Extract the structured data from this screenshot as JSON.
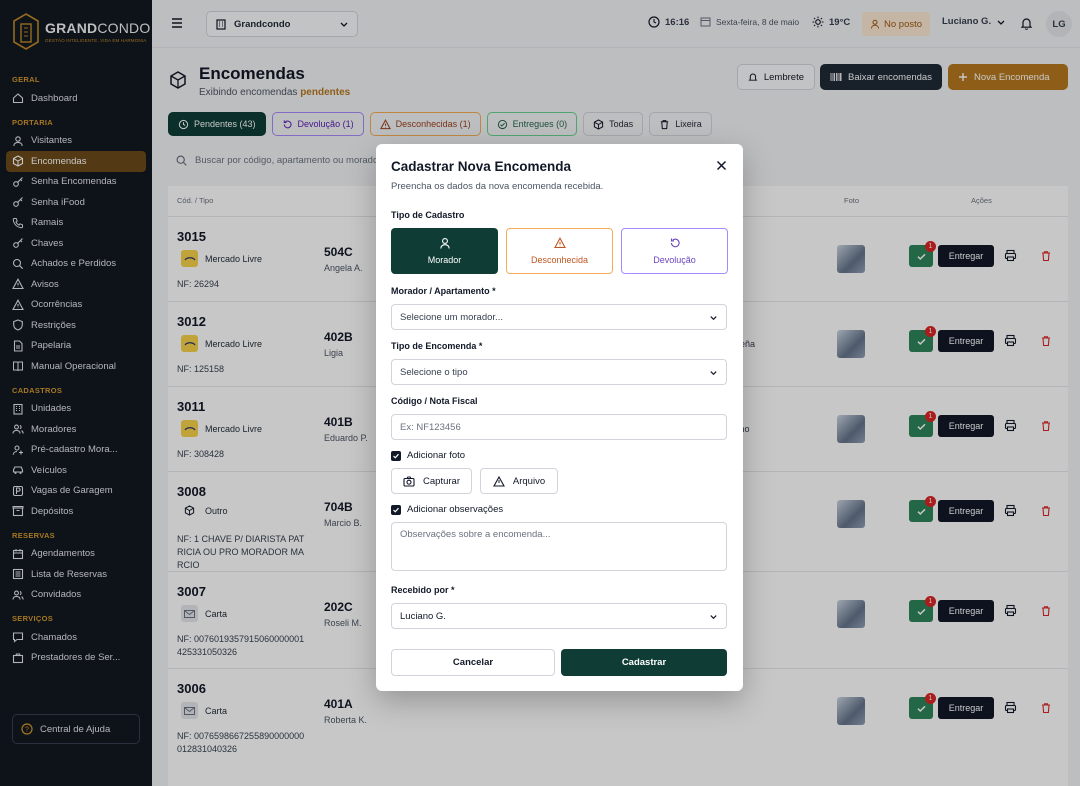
{
  "brand": {
    "name_bold": "GRAND",
    "name_rest": "CONDO",
    "tagline": "GESTÃO INTELIGENTE, VIDA EM HARMONIA"
  },
  "sidebar": {
    "sections": [
      {
        "title": "GERAL",
        "items": [
          {
            "label": "Dashboard",
            "icon": "home-icon"
          }
        ]
      },
      {
        "title": "PORTARIA",
        "items": [
          {
            "label": "Visitantes",
            "icon": "user-icon"
          },
          {
            "label": "Encomendas",
            "icon": "package-icon",
            "active": true
          },
          {
            "label": "Senha Encomendas",
            "icon": "key-icon"
          },
          {
            "label": "Senha iFood",
            "icon": "key-icon"
          },
          {
            "label": "Ramais",
            "icon": "phone-icon"
          },
          {
            "label": "Chaves",
            "icon": "key-icon"
          },
          {
            "label": "Achados e Perdidos",
            "icon": "search-icon"
          },
          {
            "label": "Avisos",
            "icon": "alert-icon"
          },
          {
            "label": "Ocorrências",
            "icon": "alert-icon"
          },
          {
            "label": "Restrições",
            "icon": "shield-icon"
          },
          {
            "label": "Papelaria",
            "icon": "file-icon"
          },
          {
            "label": "Manual Operacional",
            "icon": "book-icon"
          }
        ]
      },
      {
        "title": "CADASTROS",
        "items": [
          {
            "label": "Unidades",
            "icon": "building-icon"
          },
          {
            "label": "Moradores",
            "icon": "users-icon"
          },
          {
            "label": "Pré-cadastro Mora...",
            "icon": "user-plus-icon"
          },
          {
            "label": "Veículos",
            "icon": "car-icon"
          },
          {
            "label": "Vagas de Garagem",
            "icon": "parking-icon"
          },
          {
            "label": "Depósitos",
            "icon": "box-icon"
          }
        ]
      },
      {
        "title": "RESERVAS",
        "items": [
          {
            "label": "Agendamentos",
            "icon": "calendar-icon"
          },
          {
            "label": "Lista de Reservas",
            "icon": "list-icon"
          },
          {
            "label": "Convidados",
            "icon": "users-icon"
          }
        ]
      },
      {
        "title": "SERVIÇOS",
        "items": [
          {
            "label": "Chamados",
            "icon": "chat-icon"
          },
          {
            "label": "Prestadores de Ser...",
            "icon": "briefcase-icon"
          }
        ]
      }
    ],
    "help_label": "Central de Ajuda"
  },
  "topbar": {
    "condo": "Grandcondo",
    "time": "16:16",
    "date": "Sexta-feira, 8 de maio",
    "weather": "19°C",
    "status": "No posto",
    "user": "Luciano G.",
    "initials": "LG"
  },
  "page": {
    "title": "Encomendas",
    "subtitle_prefix": "Exibindo encomendas",
    "subtitle_highlight": "pendentes",
    "buttons": {
      "lembrete": "Lembrete",
      "baixar": "Baixar encomendas",
      "nova": "Nova Encomenda"
    },
    "tabs": [
      {
        "label": "Pendentes (43)",
        "kind": "active",
        "icon": "clock-icon"
      },
      {
        "label": "Devolução (1)",
        "kind": "dev",
        "icon": "undo-icon"
      },
      {
        "label": "Desconhecidas (1)",
        "kind": "desc",
        "icon": "alert-icon"
      },
      {
        "label": "Entregues (0)",
        "kind": "ent",
        "icon": "check-circle-icon"
      },
      {
        "label": "Todas",
        "kind": "",
        "icon": "package-icon"
      },
      {
        "label": "Lixeira",
        "kind": "",
        "icon": "trash-icon"
      }
    ],
    "search_placeholder": "Buscar por código, apartamento ou morador..."
  },
  "table": {
    "headers": {
      "code": "Cód. / Tipo",
      "photo": "Foto",
      "actions": "Ações"
    },
    "action_label": "Entregar",
    "badge": "1",
    "rows": [
      {
        "code": "3015",
        "carrier": "Mercado Livre",
        "carrier_kind": "ml",
        "nf": "NF: 26294",
        "apt": "504C",
        "resident": "Angela A."
      },
      {
        "code": "3012",
        "carrier": "Mercado Livre",
        "carrier_kind": "ml",
        "nf": "NF: 125158",
        "apt": "402B",
        "resident": "Ligia"
      },
      {
        "code": "3011",
        "carrier": "Mercado Livre",
        "carrier_kind": "ml",
        "nf": "NF: 308428",
        "apt": "401B",
        "resident": "Eduardo P."
      },
      {
        "code": "3008",
        "carrier": "Outro",
        "carrier_kind": "outro",
        "nf": "NF: 1 CHAVE P/ DIARISTA PATRICIA OU PRO MORADOR MARCIO",
        "apt": "704B",
        "resident": "Marcio B."
      },
      {
        "code": "3007",
        "carrier": "Carta",
        "carrier_kind": "carta",
        "nf": "NF: 0076019357915060000001425331050326",
        "apt": "202C",
        "resident": "Roseli M."
      },
      {
        "code": "3006",
        "carrier": "Carta",
        "carrier_kind": "carta",
        "nf": "NF: 0076598667255890000000012831040326",
        "apt": "401A",
        "resident": "Roberta K."
      }
    ],
    "partial_texts": {
      "row1": "queña",
      "row2": "seno"
    }
  },
  "modal": {
    "title": "Cadastrar Nova Encomenda",
    "subtitle": "Preencha os dados da nova encomenda recebida.",
    "tipo_label": "Tipo de Cadastro",
    "tipos": {
      "morador": "Morador",
      "desconhecida": "Desconhecida",
      "devolucao": "Devolução"
    },
    "morador_label": "Morador / Apartamento *",
    "morador_value": "Selecione um morador...",
    "tipo_encomenda_label": "Tipo de Encomenda *",
    "tipo_encomenda_value": "Selecione o tipo",
    "codigo_label": "Código / Nota Fiscal",
    "codigo_placeholder": "Ex: NF123456",
    "foto_check": "Adicionar foto",
    "capturar": "Capturar",
    "arquivo": "Arquivo",
    "obs_check": "Adicionar observações",
    "obs_placeholder": "Observações sobre a encomenda...",
    "recebido_label": "Recebido por *",
    "recebido_value": "Luciano G.",
    "cancel": "Cancelar",
    "submit": "Cadastrar"
  }
}
